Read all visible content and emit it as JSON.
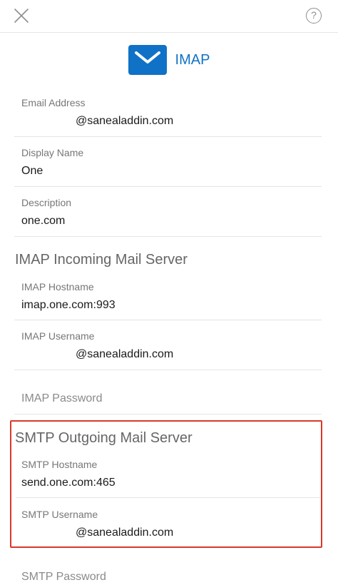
{
  "header": {
    "help_glyph": "?"
  },
  "brand": {
    "label": "IMAP",
    "accent_color": "#0F72C6",
    "icon": "envelope-icon"
  },
  "account": {
    "email_label": "Email Address",
    "email_value": "@sanealaddin.com",
    "display_name_label": "Display Name",
    "display_name_value": "One",
    "description_label": "Description",
    "description_value": "one.com"
  },
  "imap": {
    "section_title": "IMAP Incoming Mail Server",
    "hostname_label": "IMAP Hostname",
    "hostname_value": "imap.one.com:993",
    "username_label": "IMAP Username",
    "username_value": "@sanealaddin.com",
    "password_placeholder": "IMAP Password"
  },
  "smtp": {
    "section_title": "SMTP Outgoing Mail Server",
    "hostname_label": "SMTP Hostname",
    "hostname_value": "send.one.com:465",
    "username_label": "SMTP Username",
    "username_value": "@sanealaddin.com",
    "password_placeholder": "SMTP Password",
    "highlight_color": "#D9382A"
  }
}
